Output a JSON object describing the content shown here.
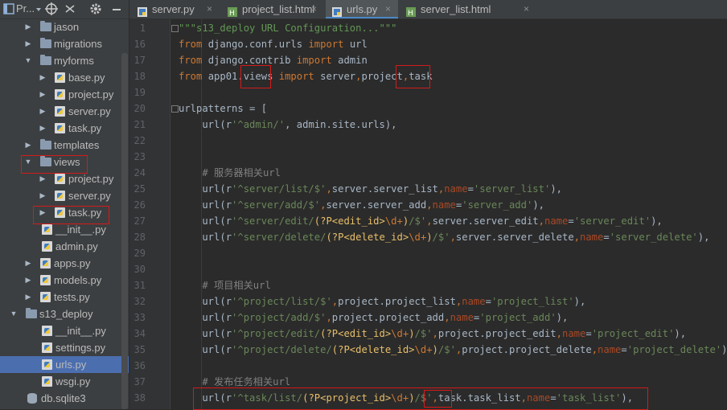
{
  "project_panel": {
    "title": "Pr...",
    "tree": [
      {
        "label": "jason",
        "type": "folder",
        "indent": 2,
        "expanded": false
      },
      {
        "label": "migrations",
        "type": "folder",
        "indent": 2,
        "expanded": false
      },
      {
        "label": "myforms",
        "type": "folder",
        "indent": 2,
        "expanded": true
      },
      {
        "label": "base.py",
        "type": "py",
        "indent": 3,
        "expanded": false
      },
      {
        "label": "project.py",
        "type": "py",
        "indent": 3,
        "expanded": false
      },
      {
        "label": "server.py",
        "type": "py",
        "indent": 3,
        "expanded": false
      },
      {
        "label": "task.py",
        "type": "py",
        "indent": 3,
        "expanded": false
      },
      {
        "label": "templates",
        "type": "folder",
        "indent": 2,
        "expanded": false
      },
      {
        "label": "views",
        "type": "folder",
        "indent": 2,
        "expanded": true
      },
      {
        "label": "project.py",
        "type": "py",
        "indent": 3,
        "expanded": false
      },
      {
        "label": "server.py",
        "type": "py",
        "indent": 3,
        "expanded": false
      },
      {
        "label": "task.py",
        "type": "py",
        "indent": 3,
        "expanded": false
      },
      {
        "label": "__init__.py",
        "type": "pyleaf",
        "indent": 2
      },
      {
        "label": "admin.py",
        "type": "pyleaf",
        "indent": 2
      },
      {
        "label": "apps.py",
        "type": "py",
        "indent": 2,
        "expanded": false
      },
      {
        "label": "models.py",
        "type": "py",
        "indent": 2,
        "expanded": false
      },
      {
        "label": "tests.py",
        "type": "py",
        "indent": 2,
        "expanded": false
      },
      {
        "label": "s13_deploy",
        "type": "folder",
        "indent": 1,
        "expanded": true
      },
      {
        "label": "__init__.py",
        "type": "pyleaf",
        "indent": 2
      },
      {
        "label": "settings.py",
        "type": "pyleaf",
        "indent": 2
      },
      {
        "label": "urls.py",
        "type": "pyleaf",
        "indent": 2,
        "selected": true
      },
      {
        "label": "wsgi.py",
        "type": "pyleaf",
        "indent": 2
      },
      {
        "label": "db.sqlite3",
        "type": "db",
        "indent": 1
      }
    ]
  },
  "tabs": [
    {
      "label": "server.py",
      "icon": "python-file-icon",
      "active": false
    },
    {
      "label": "project_list.html",
      "icon": "html-file-icon",
      "active": false
    },
    {
      "label": "urls.py",
      "icon": "python-file-icon",
      "active": true
    },
    {
      "label": "server_list.html",
      "icon": "html-file-icon",
      "active": false
    }
  ],
  "editor": {
    "line_numbers": [
      "1",
      "16",
      "17",
      "18",
      "19",
      "20",
      "21",
      "22",
      "23",
      "24",
      "25",
      "26",
      "27",
      "28",
      "29",
      "30",
      "31",
      "32",
      "33",
      "34",
      "35",
      "36",
      "37",
      "38"
    ],
    "lines": [
      [
        [
          "ds",
          "\"\"\"s13_deploy URL Configuration...\"\"\""
        ]
      ],
      [
        [
          "kw",
          "from "
        ],
        [
          "t",
          "django.conf.urls "
        ],
        [
          "kw",
          "import "
        ],
        [
          "t",
          "url"
        ]
      ],
      [
        [
          "kw",
          "from "
        ],
        [
          "t",
          "django.contrib "
        ],
        [
          "kw",
          "import "
        ],
        [
          "t",
          "admin"
        ]
      ],
      [
        [
          "kw",
          "from "
        ],
        [
          "t",
          "app01."
        ],
        [
          "t",
          "views"
        ],
        [
          "t",
          " "
        ],
        [
          "kw",
          "import "
        ],
        [
          "t",
          "server"
        ],
        [
          "kw",
          ","
        ],
        [
          "t",
          "project"
        ],
        [
          "kw",
          ","
        ],
        [
          "t",
          "task"
        ]
      ],
      [],
      [
        [
          "t",
          "urlpatterns = ["
        ]
      ],
      [
        [
          "t",
          "    url(r"
        ],
        [
          "st",
          "'^admin/'"
        ],
        [
          "t",
          ", admin.site.urls),"
        ]
      ],
      [],
      [],
      [
        [
          "cm",
          "    # 服务器相关url"
        ]
      ],
      [
        [
          "t",
          "    url(r"
        ],
        [
          "st",
          "'^server/list/$'"
        ],
        [
          "kw",
          ","
        ],
        [
          "t",
          "server.server_list"
        ],
        [
          "kw",
          ","
        ],
        [
          "pm",
          "name"
        ],
        [
          "t",
          "="
        ],
        [
          "st",
          "'server_list'"
        ],
        [
          "t",
          "),"
        ]
      ],
      [
        [
          "t",
          "    url(r"
        ],
        [
          "st",
          "'^server/add/$'"
        ],
        [
          "kw",
          ","
        ],
        [
          "t",
          "server.server_add"
        ],
        [
          "kw",
          ","
        ],
        [
          "pm",
          "name"
        ],
        [
          "t",
          "="
        ],
        [
          "st",
          "'server_add'"
        ],
        [
          "t",
          "),"
        ]
      ],
      [
        [
          "t",
          "    url(r"
        ],
        [
          "st",
          "'^server/edit/"
        ],
        [
          "gp",
          "(?P<edit_id>"
        ],
        [
          "bs",
          "\\d+"
        ],
        [
          "gp",
          ")"
        ],
        [
          "st",
          "/$'"
        ],
        [
          "kw",
          ","
        ],
        [
          "t",
          "server.server_edit"
        ],
        [
          "kw",
          ","
        ],
        [
          "pm",
          "name"
        ],
        [
          "t",
          "="
        ],
        [
          "st",
          "'server_edit'"
        ],
        [
          "t",
          "),"
        ]
      ],
      [
        [
          "t",
          "    url(r"
        ],
        [
          "st",
          "'^server/delete/"
        ],
        [
          "gp",
          "(?P<delete_id>"
        ],
        [
          "bs",
          "\\d+"
        ],
        [
          "gp",
          ")"
        ],
        [
          "st",
          "/$'"
        ],
        [
          "kw",
          ","
        ],
        [
          "t",
          "server.server_delete"
        ],
        [
          "kw",
          ","
        ],
        [
          "pm",
          "name"
        ],
        [
          "t",
          "="
        ],
        [
          "st",
          "'server_delete'"
        ],
        [
          "t",
          "),"
        ]
      ],
      [],
      [],
      [
        [
          "cm",
          "    # 项目相关url"
        ]
      ],
      [
        [
          "t",
          "    url(r"
        ],
        [
          "st",
          "'^project/list/$'"
        ],
        [
          "kw",
          ","
        ],
        [
          "t",
          "project.project_list"
        ],
        [
          "kw",
          ","
        ],
        [
          "pm",
          "name"
        ],
        [
          "t",
          "="
        ],
        [
          "st",
          "'project_list'"
        ],
        [
          "t",
          "),"
        ]
      ],
      [
        [
          "t",
          "    url(r"
        ],
        [
          "st",
          "'^project/add/$'"
        ],
        [
          "kw",
          ","
        ],
        [
          "t",
          "project.project_add"
        ],
        [
          "kw",
          ","
        ],
        [
          "pm",
          "name"
        ],
        [
          "t",
          "="
        ],
        [
          "st",
          "'project_add'"
        ],
        [
          "t",
          "),"
        ]
      ],
      [
        [
          "t",
          "    url(r"
        ],
        [
          "st",
          "'^project/edit/"
        ],
        [
          "gp",
          "(?P<edit_id>"
        ],
        [
          "bs",
          "\\d+"
        ],
        [
          "gp",
          ")"
        ],
        [
          "st",
          "/$'"
        ],
        [
          "kw",
          ","
        ],
        [
          "t",
          "project.project_edit"
        ],
        [
          "kw",
          ","
        ],
        [
          "pm",
          "name"
        ],
        [
          "t",
          "="
        ],
        [
          "st",
          "'project_edit'"
        ],
        [
          "t",
          "),"
        ]
      ],
      [
        [
          "t",
          "    url(r"
        ],
        [
          "st",
          "'^project/delete/"
        ],
        [
          "gp",
          "(?P<delete_id>"
        ],
        [
          "bs",
          "\\d+"
        ],
        [
          "gp",
          ")"
        ],
        [
          "st",
          "/$'"
        ],
        [
          "kw",
          ","
        ],
        [
          "t",
          "project.project_delete"
        ],
        [
          "kw",
          ","
        ],
        [
          "pm",
          "name"
        ],
        [
          "t",
          "="
        ],
        [
          "st",
          "'project_delete'"
        ],
        [
          "t",
          "),"
        ]
      ],
      [],
      [
        [
          "cm",
          "    # 发布任务相关url"
        ]
      ],
      [
        [
          "t",
          "    url(r"
        ],
        [
          "st",
          "'^task/list/"
        ],
        [
          "gp",
          "(?P<project_id>"
        ],
        [
          "bs",
          "\\d+"
        ],
        [
          "gp",
          ")"
        ],
        [
          "st",
          "/$'"
        ],
        [
          "kw",
          ","
        ],
        [
          "t",
          "task"
        ],
        [
          "t",
          ".task_list"
        ],
        [
          "kw",
          ","
        ],
        [
          "pm",
          "name"
        ],
        [
          "t",
          "="
        ],
        [
          "st",
          "'task_list'"
        ],
        [
          "t",
          "),"
        ]
      ]
    ]
  },
  "colors": {
    "keyword": "#cc7832",
    "string": "#6a8759",
    "comment": "#808080",
    "param": "#aa4926",
    "highlight_box": "#d41a1a",
    "selection": "#4b6eaf"
  }
}
